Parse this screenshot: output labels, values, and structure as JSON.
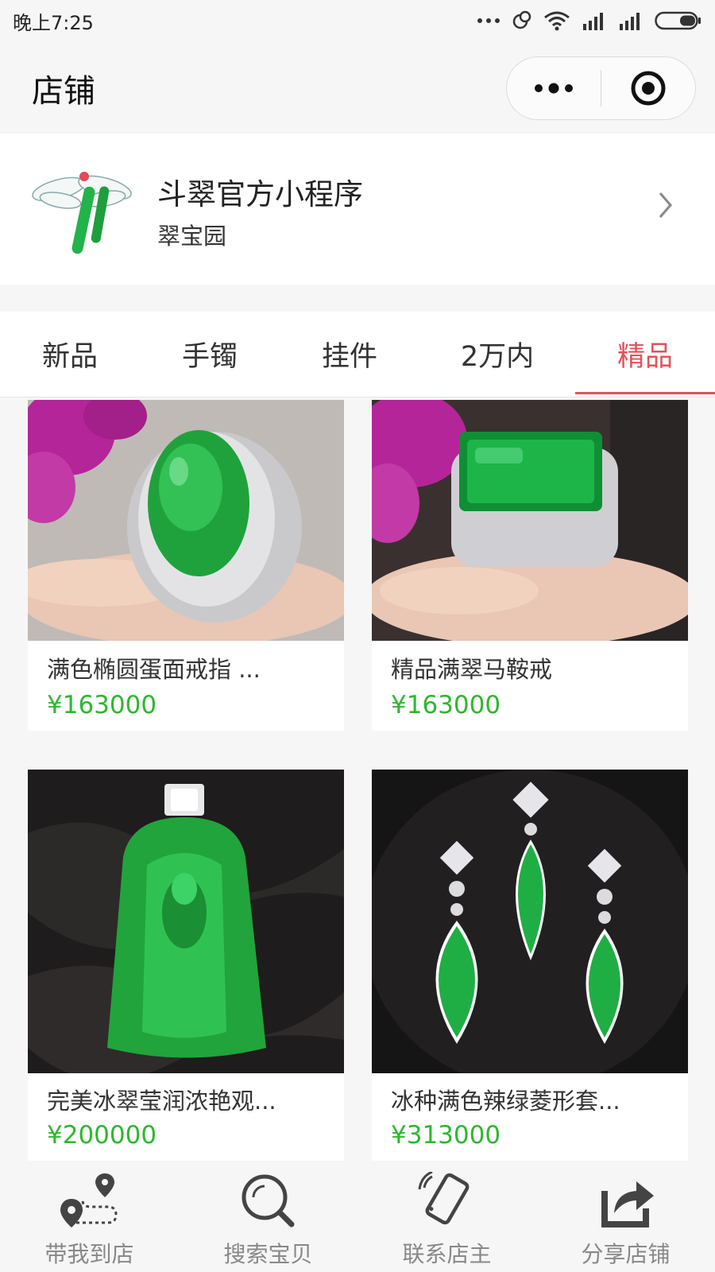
{
  "status_bar": {
    "time": "晚上7:25"
  },
  "nav": {
    "title": "店铺"
  },
  "shop": {
    "name": "斗翠官方小程序",
    "subtitle": "翠宝园"
  },
  "tabs": [
    {
      "label": "新品",
      "active": false
    },
    {
      "label": "手镯",
      "active": false
    },
    {
      "label": "挂件",
      "active": false
    },
    {
      "label": "2万内",
      "active": false
    },
    {
      "label": "精品",
      "active": true
    }
  ],
  "products": [
    {
      "title": "满色椭圆蛋面戒指 ...",
      "price": "¥163000"
    },
    {
      "title": "精品满翠马鞍戒",
      "price": "¥163000"
    },
    {
      "title": "完美冰翠莹润浓艳观...",
      "price": "¥200000"
    },
    {
      "title": "冰种满色辣绿菱形套...",
      "price": "¥313000"
    }
  ],
  "bottom_bar": [
    {
      "label": "带我到店",
      "icon": "map-route-icon"
    },
    {
      "label": "搜索宝贝",
      "icon": "search-icon"
    },
    {
      "label": "联系店主",
      "icon": "phone-icon"
    },
    {
      "label": "分享店铺",
      "icon": "share-icon"
    }
  ],
  "colors": {
    "accent": "#e0525c",
    "price": "#2db82d",
    "background": "#f6f6f6"
  }
}
